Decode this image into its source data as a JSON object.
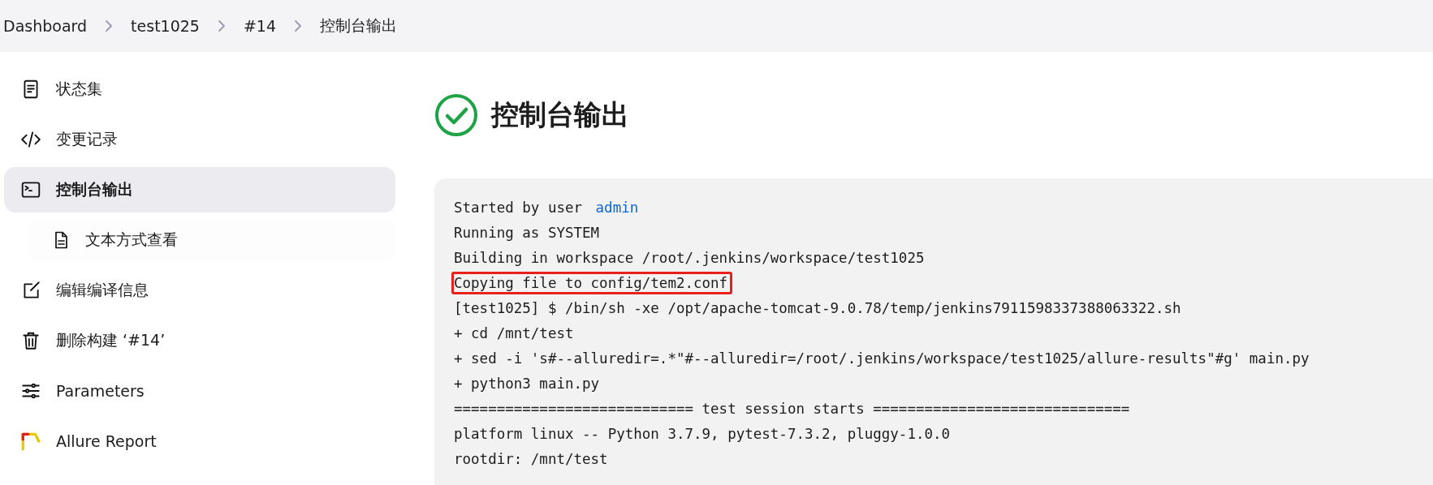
{
  "breadcrumb": [
    "Dashboard",
    "test1025",
    "#14",
    "控制台输出"
  ],
  "sidebar": {
    "items": [
      {
        "label": "状态集",
        "selected": false
      },
      {
        "label": "变更记录",
        "selected": false
      },
      {
        "label": "控制台输出",
        "selected": true,
        "children": [
          {
            "label": "文本方式查看",
            "selected": false
          }
        ]
      },
      {
        "label": "编辑编译信息",
        "selected": false
      },
      {
        "label": "删除构建 ‘#14’",
        "selected": false
      },
      {
        "label": "Parameters",
        "selected": false
      },
      {
        "label": "Allure Report",
        "selected": false
      }
    ]
  },
  "heading": {
    "title": "控制台输出"
  },
  "console": {
    "lines": [
      {
        "text": "Started by user",
        "link": "admin",
        "highlighted": false
      },
      {
        "text": "Running as SYSTEM",
        "highlighted": false
      },
      {
        "text": "Building in workspace /root/.jenkins/workspace/test1025",
        "highlighted": false
      },
      {
        "text": "Copying file to config/tem2.conf",
        "highlighted": true
      },
      {
        "text": "[test1025] $ /bin/sh -xe /opt/apache-tomcat-9.0.78/temp/jenkins7911598337388063322.sh",
        "highlighted": false
      },
      {
        "text": "+ cd /mnt/test",
        "highlighted": false
      },
      {
        "text": "+ sed -i 's#--alluredir=.*\"#--alluredir=/root/.jenkins/workspace/test1025/allure-results\"#g' main.py",
        "highlighted": false
      },
      {
        "text": "+ python3 main.py",
        "highlighted": false
      },
      {
        "text": "============================ test session starts ==============================",
        "highlighted": false
      },
      {
        "text": "platform linux -- Python 3.7.9, pytest-7.3.2, pluggy-1.0.0",
        "highlighted": false
      },
      {
        "text": "rootdir: /mnt/test",
        "highlighted": false
      }
    ]
  }
}
